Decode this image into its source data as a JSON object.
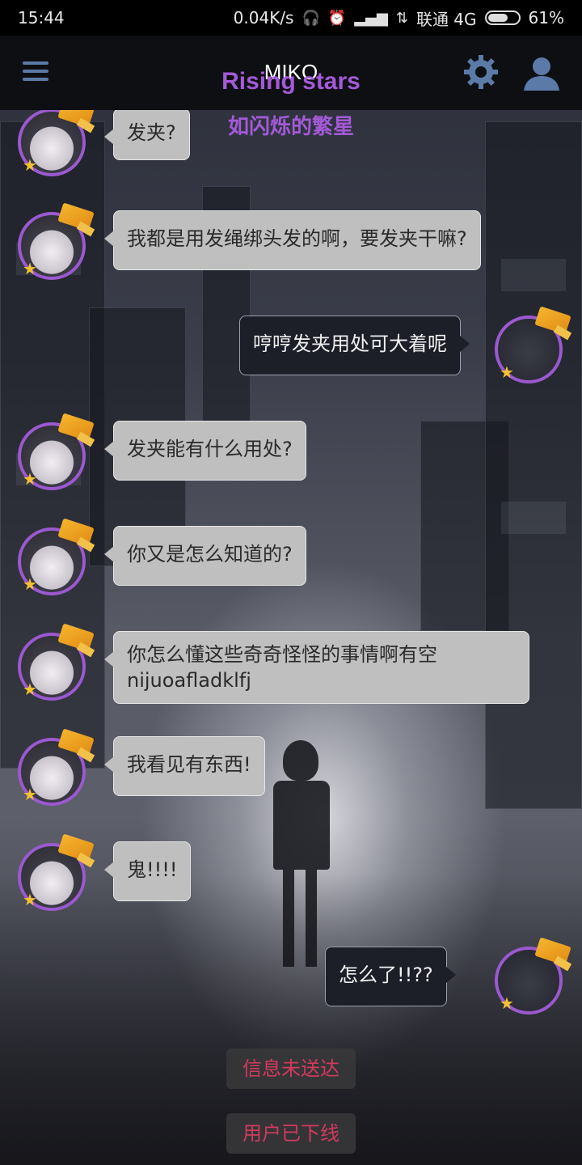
{
  "status_bar": {
    "time": "15:44",
    "net_speed": "0.04K/s",
    "carrier": "联通 4G",
    "battery": "61%",
    "battery_level": 0.61
  },
  "header": {
    "title": "MIKO",
    "brand": "Rising stars",
    "subtitle": "如闪烁的繁星",
    "brand_color": "#a45ad8",
    "icons": [
      "menu-icon",
      "gear-icon",
      "user-icon"
    ]
  },
  "messages": [
    {
      "side": "in",
      "text": "发夹?"
    },
    {
      "side": "in",
      "text": "我都是用发绳绑头发的啊，要发夹干嘛?"
    },
    {
      "side": "out",
      "text": "哼哼发夹用处可大着呢"
    },
    {
      "side": "in",
      "text": "发夹能有什么用处?"
    },
    {
      "side": "in",
      "text": "你又是怎么知道的?"
    },
    {
      "side": "in",
      "text": "你怎么懂这些奇奇怪怪的事情啊有空",
      "text2": "nijuoafladklfj"
    },
    {
      "side": "in",
      "text": "我看见有东西!"
    },
    {
      "side": "in",
      "text": "鬼!!!!"
    },
    {
      "side": "out",
      "text": "怎么了!!??"
    }
  ],
  "notices": [
    {
      "text": "信息未送达"
    },
    {
      "text": "用户已下线"
    }
  ],
  "colors": {
    "notice_text": "#d23a5c",
    "avatar_ring": "#9b59d0"
  }
}
